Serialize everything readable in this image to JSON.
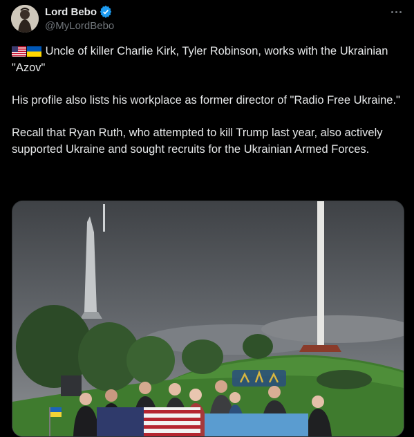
{
  "author": {
    "display_name": "Lord Bebo",
    "handle": "@MyLordBebo",
    "verified": true
  },
  "tweet": {
    "flags": [
      "us-flag-icon",
      "ukraine-flag-icon"
    ],
    "paragraphs": [
      "Uncle of killer Charlie Kirk, Tyler Robinson, works with the Ukrainian \"Azov\"",
      "His profile also lists his workplace as former director of \"Radio Free Ukraine.\"",
      "Recall that Ryan Ruth, who attempted to kill Trump last year, also actively supported Ukraine and sought recruits for the Ukrainian Armed Forces."
    ]
  },
  "colors": {
    "background": "#000000",
    "text": "#e7e9ea",
    "secondary": "#71767b",
    "verified": "#1d9bf0"
  },
  "media": {
    "icon": "photo-group-in-front-of-monument-icon"
  }
}
